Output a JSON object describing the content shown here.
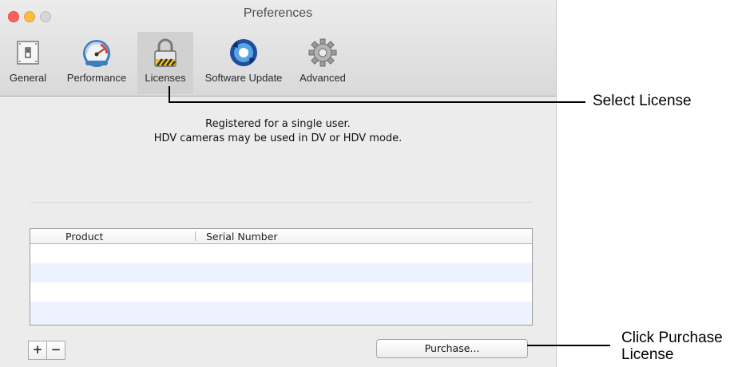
{
  "window": {
    "title": "Preferences"
  },
  "toolbar": {
    "items": [
      {
        "label": "General",
        "icon": "switch-icon"
      },
      {
        "label": "Performance",
        "icon": "speedometer-icon"
      },
      {
        "label": "Licenses",
        "icon": "padlock-icon",
        "selected": true
      },
      {
        "label": "Software Update",
        "icon": "update-arrows-icon"
      },
      {
        "label": "Advanced",
        "icon": "gear-icon"
      }
    ]
  },
  "registration": {
    "line1": "Registered for a single user.",
    "line2": "HDV cameras may be used in DV or HDV mode."
  },
  "table": {
    "columns": [
      "Product",
      "Serial Number"
    ],
    "rows": []
  },
  "controls": {
    "add_label": "+",
    "remove_label": "−",
    "purchase_label": "Purchase..."
  },
  "annotations": {
    "select_license": "Select License",
    "click_purchase_line1": "Click Purchase",
    "click_purchase_line2": "License"
  },
  "colors": {
    "close": "#fc615d",
    "minimize": "#fdbc40",
    "zoom_disabled": "#d6d6d6",
    "selected_tab": "#d1d1d1",
    "alt_row": "#edf3fe"
  }
}
